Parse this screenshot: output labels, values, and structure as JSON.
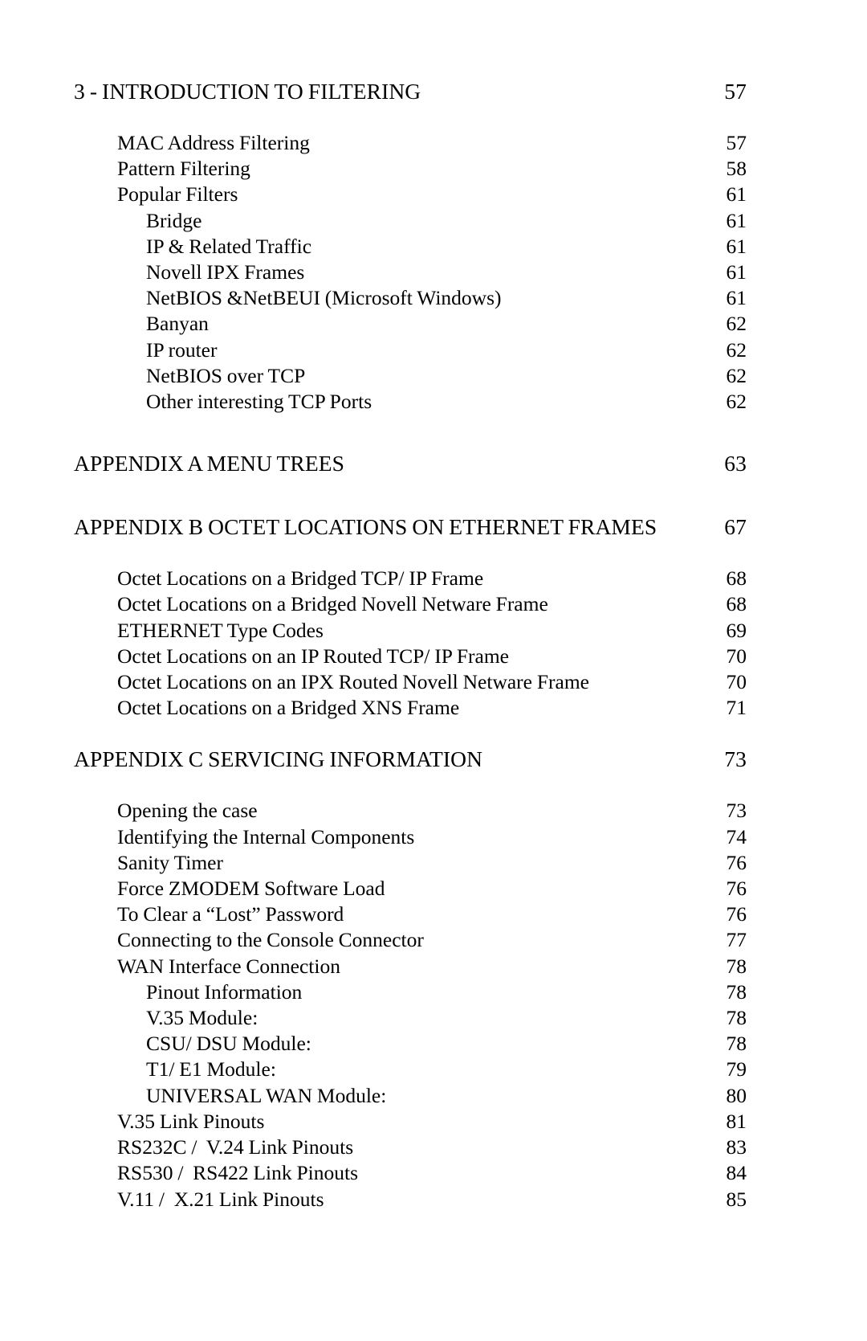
{
  "document": {
    "type": "table-of-contents",
    "page_background": "#ffffff",
    "text_color": "#000000"
  },
  "toc": {
    "entries": [
      {
        "level": 0,
        "title": "3 - INTRODUCTION TO FILTERING",
        "page": "57",
        "spacing": "none",
        "wrap": false
      },
      {
        "level": 1,
        "title": "MAC Address Filtering",
        "page": "57",
        "spacing": "md",
        "wrap": false
      },
      {
        "level": 1,
        "title": "Pattern Filtering",
        "page": "58",
        "spacing": "none",
        "wrap": false
      },
      {
        "level": 1,
        "title": "Popular Filters",
        "page": "61",
        "spacing": "none",
        "wrap": false
      },
      {
        "level": 2,
        "title": "Bridge",
        "page": "61",
        "spacing": "none",
        "wrap": false
      },
      {
        "level": 2,
        "title": "IP & Related Traffic",
        "page": "61",
        "spacing": "none",
        "wrap": false
      },
      {
        "level": 2,
        "title": "Novell IPX Frames",
        "page": "61",
        "spacing": "none",
        "wrap": false
      },
      {
        "level": 2,
        "title": "NetBIOS &NetBEUI (Microsoft Windows)",
        "page": "61",
        "spacing": "none",
        "wrap": false
      },
      {
        "level": 2,
        "title": "Banyan",
        "page": "62",
        "spacing": "none",
        "wrap": false
      },
      {
        "level": 2,
        "title": "IP router",
        "page": "62",
        "spacing": "none",
        "wrap": false
      },
      {
        "level": 2,
        "title": "NetBIOS over TCP",
        "page": "62",
        "spacing": "none",
        "wrap": false
      },
      {
        "level": 2,
        "title": "Other interesting TCP Ports",
        "page": "62",
        "spacing": "none",
        "wrap": false
      },
      {
        "level": 0,
        "title": "APPENDIX A MENU TREES",
        "page": "63",
        "spacing": "lg",
        "wrap": false
      },
      {
        "level": 0,
        "title": "APPENDIX B OCTET LOCATIONS ON  ETHERNET FRAMES",
        "page": "67",
        "spacing": "lg",
        "wrap": true
      },
      {
        "level": 1,
        "title": "Octet Locations on a Bridged TCP/ IP Frame",
        "page": "68",
        "spacing": "md",
        "wrap": false
      },
      {
        "level": 1,
        "title": "Octet Locations on a Bridged Novell Netware Frame",
        "page": "68",
        "spacing": "none",
        "wrap": false
      },
      {
        "level": 1,
        "title": "ETHERNET Type Codes",
        "page": "69",
        "spacing": "none",
        "wrap": false
      },
      {
        "level": 1,
        "title": "Octet Locations on an IP Routed TCP/ IP Frame",
        "page": "70",
        "spacing": "none",
        "wrap": false
      },
      {
        "level": 1,
        "title": "Octet Locations on an IPX Routed Novell Netware Frame",
        "page": "70",
        "spacing": "none",
        "wrap": false
      },
      {
        "level": 1,
        "title": "Octet Locations on a Bridged XNS Frame",
        "page": "71",
        "spacing": "none",
        "wrap": false
      },
      {
        "level": 0,
        "title": "APPENDIX C SERVICING INFORMATION",
        "page": "73",
        "spacing": "md",
        "wrap": false
      },
      {
        "level": 1,
        "title": "Opening the case",
        "page": "73",
        "spacing": "md",
        "wrap": false
      },
      {
        "level": 1,
        "title": "Identifying the Internal Components",
        "page": "74",
        "spacing": "none",
        "wrap": false
      },
      {
        "level": 1,
        "title": "Sanity Timer",
        "page": "76",
        "spacing": "none",
        "wrap": false
      },
      {
        "level": 1,
        "title": "Force ZMODEM Software Load",
        "page": "76",
        "spacing": "none",
        "wrap": false
      },
      {
        "level": 1,
        "title": "To Clear a “Lost” Password",
        "page": "76",
        "spacing": "none",
        "wrap": false
      },
      {
        "level": 1,
        "title": "Connecting to the Console Connector",
        "page": "77",
        "spacing": "none",
        "wrap": false
      },
      {
        "level": 1,
        "title": "WAN Interface Connection",
        "page": "78",
        "spacing": "none",
        "wrap": false
      },
      {
        "level": 2,
        "title": "Pinout Information",
        "page": "78",
        "spacing": "none",
        "wrap": false
      },
      {
        "level": 2,
        "title": "V.35 Module:",
        "page": "78",
        "spacing": "none",
        "wrap": false
      },
      {
        "level": 2,
        "title": "CSU/ DSU Module:",
        "page": "78",
        "spacing": "none",
        "wrap": false
      },
      {
        "level": 2,
        "title": "T1/ E1 Module:",
        "page": "79",
        "spacing": "none",
        "wrap": false
      },
      {
        "level": 2,
        "title": "UNIVERSAL WAN Module:",
        "page": "80",
        "spacing": "none",
        "wrap": false
      },
      {
        "level": 1,
        "title": "V.35 Link Pinouts",
        "page": "81",
        "spacing": "none",
        "wrap": false
      },
      {
        "level": 1,
        "title": "RS232C /  V.24 Link Pinouts",
        "page": "83",
        "spacing": "none",
        "wrap": false
      },
      {
        "level": 1,
        "title": "RS530 /  RS422 Link Pinouts",
        "page": "84",
        "spacing": "none",
        "wrap": false
      },
      {
        "level": 1,
        "title": "V.11 /  X.21 Link Pinouts",
        "page": "85",
        "spacing": "none",
        "wrap": false
      }
    ]
  }
}
